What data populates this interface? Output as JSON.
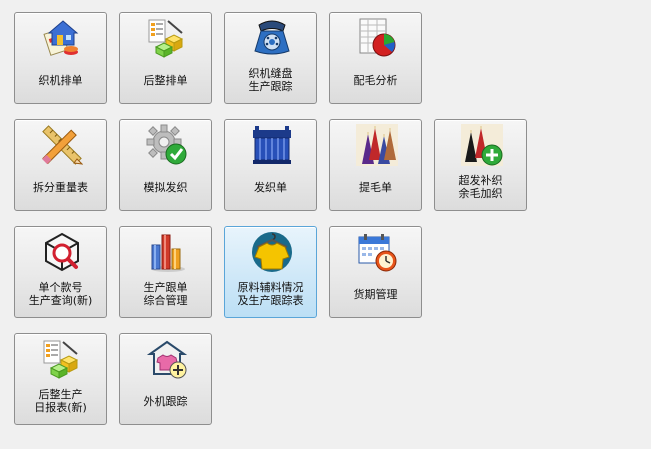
{
  "tiles": [
    {
      "label": "织机排单",
      "icon": "home-schedule-icon"
    },
    {
      "label": "后整排单",
      "icon": "blocks-list-icon"
    },
    {
      "label": "织机缝盘\n生产跟踪",
      "icon": "telephone-icon"
    },
    {
      "label": "配毛分析",
      "icon": "spreadsheet-pie-icon"
    },
    {
      "label": "拆分重量表",
      "icon": "pencil-ruler-icon"
    },
    {
      "label": "模拟发织",
      "icon": "gear-check-icon"
    },
    {
      "label": "发织单",
      "icon": "knitting-machine-icon"
    },
    {
      "label": "提毛单",
      "icon": "yarn-spools-icon"
    },
    {
      "label": "超发补织\n余毛加织",
      "icon": "spools-add-icon"
    },
    {
      "label": "单个款号\n生产查询(新)",
      "icon": "box-search-icon"
    },
    {
      "label": "生产跟单\n综合管理",
      "icon": "bar-chart-icon"
    },
    {
      "label": "原料辅料情况\n及生产跟踪表",
      "icon": "sweater-hanger-icon"
    },
    {
      "label": "货期管理",
      "icon": "calendar-clock-icon"
    },
    {
      "label": "后整生产\n日报表(新)",
      "icon": "blocks-list-icon"
    },
    {
      "label": "外机跟踪",
      "icon": "garment-add-icon"
    }
  ]
}
